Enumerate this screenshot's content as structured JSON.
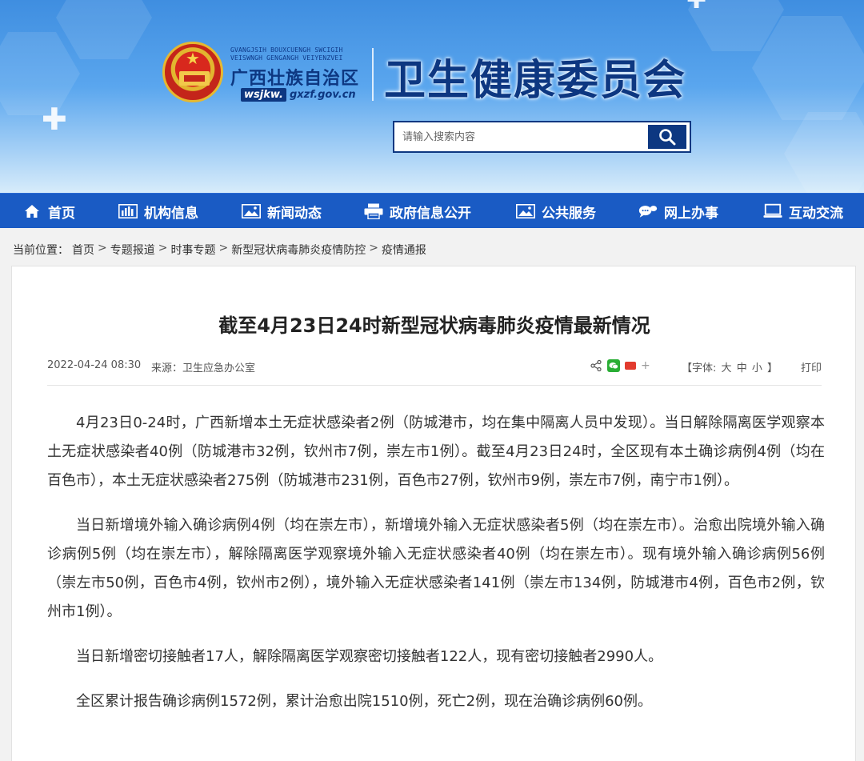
{
  "header": {
    "emblem_zhuang_line1": "GVANGJSIH BOUXCUENGH SWCIGIH",
    "emblem_zhuang_line2": "VEISWNGH GENGANGH VEIYENZVEI",
    "region_name": "广西壮族自治区",
    "domain_badge": "wsjkw.",
    "domain_suffix": "gxzf.gov.cn",
    "site_title": "卫生健康委员会"
  },
  "search": {
    "placeholder": "请输入搜索内容"
  },
  "nav": {
    "items": [
      {
        "label": "首页",
        "icon": "home-icon"
      },
      {
        "label": "机构信息",
        "icon": "bar-chart-icon"
      },
      {
        "label": "新闻动态",
        "icon": "image-icon"
      },
      {
        "label": "政府信息公开",
        "icon": "printer-icon"
      },
      {
        "label": "公共服务",
        "icon": "picture-icon"
      },
      {
        "label": "网上办事",
        "icon": "chat-icon"
      },
      {
        "label": "互动交流",
        "icon": "monitor-icon"
      }
    ]
  },
  "breadcrumb": {
    "prefix": "当前位置：",
    "items": [
      "首页",
      "专题报道",
      "时事专题",
      "新型冠状病毒肺炎疫情防控",
      "疫情通报"
    ],
    "separator": ">"
  },
  "article": {
    "title": "截至4月23日24时新型冠状病毒肺炎疫情最新情况",
    "date": "2022-04-24 08:30",
    "source": "来源：卫生应急办公室",
    "font_size_label_open": "【字体:",
    "font_large": "大",
    "font_medium": "中",
    "font_small": "小",
    "font_size_label_close": "】",
    "print_label": "打印",
    "share_plus": "+",
    "paragraphs": [
      "4月23日0-24时，广西新增本土无症状感染者2例（防城港市，均在集中隔离人员中发现）。当日解除隔离医学观察本土无症状感染者40例（防城港市32例，钦州市7例，崇左市1例）。截至4月23日24时，全区现有本土确诊病例4例（均在百色市），本土无症状感染者275例（防城港市231例，百色市27例，钦州市9例，崇左市7例，南宁市1例）。",
      "当日新增境外输入确诊病例4例（均在崇左市），新增境外输入无症状感染者5例（均在崇左市）。治愈出院境外输入确诊病例5例（均在崇左市），解除隔离医学观察境外输入无症状感染者40例（均在崇左市）。现有境外输入确诊病例56例（崇左市50例，百色市4例，钦州市2例），境外输入无症状感染者141例（崇左市134例，防城港市4例，百色市2例，钦州市1例）。",
      "当日新增密切接触者17人，解除隔离医学观察密切接触者122人，现有密切接触者2990人。",
      "全区累计报告确诊病例1572例，累计治愈出院1510例，死亡2例，现在治确诊病例60例。"
    ]
  },
  "colors": {
    "nav_bg": "#1a5bc4",
    "brand_dark": "#0d3781",
    "emblem_red": "#d8281d",
    "emblem_gold": "#e6b830"
  }
}
